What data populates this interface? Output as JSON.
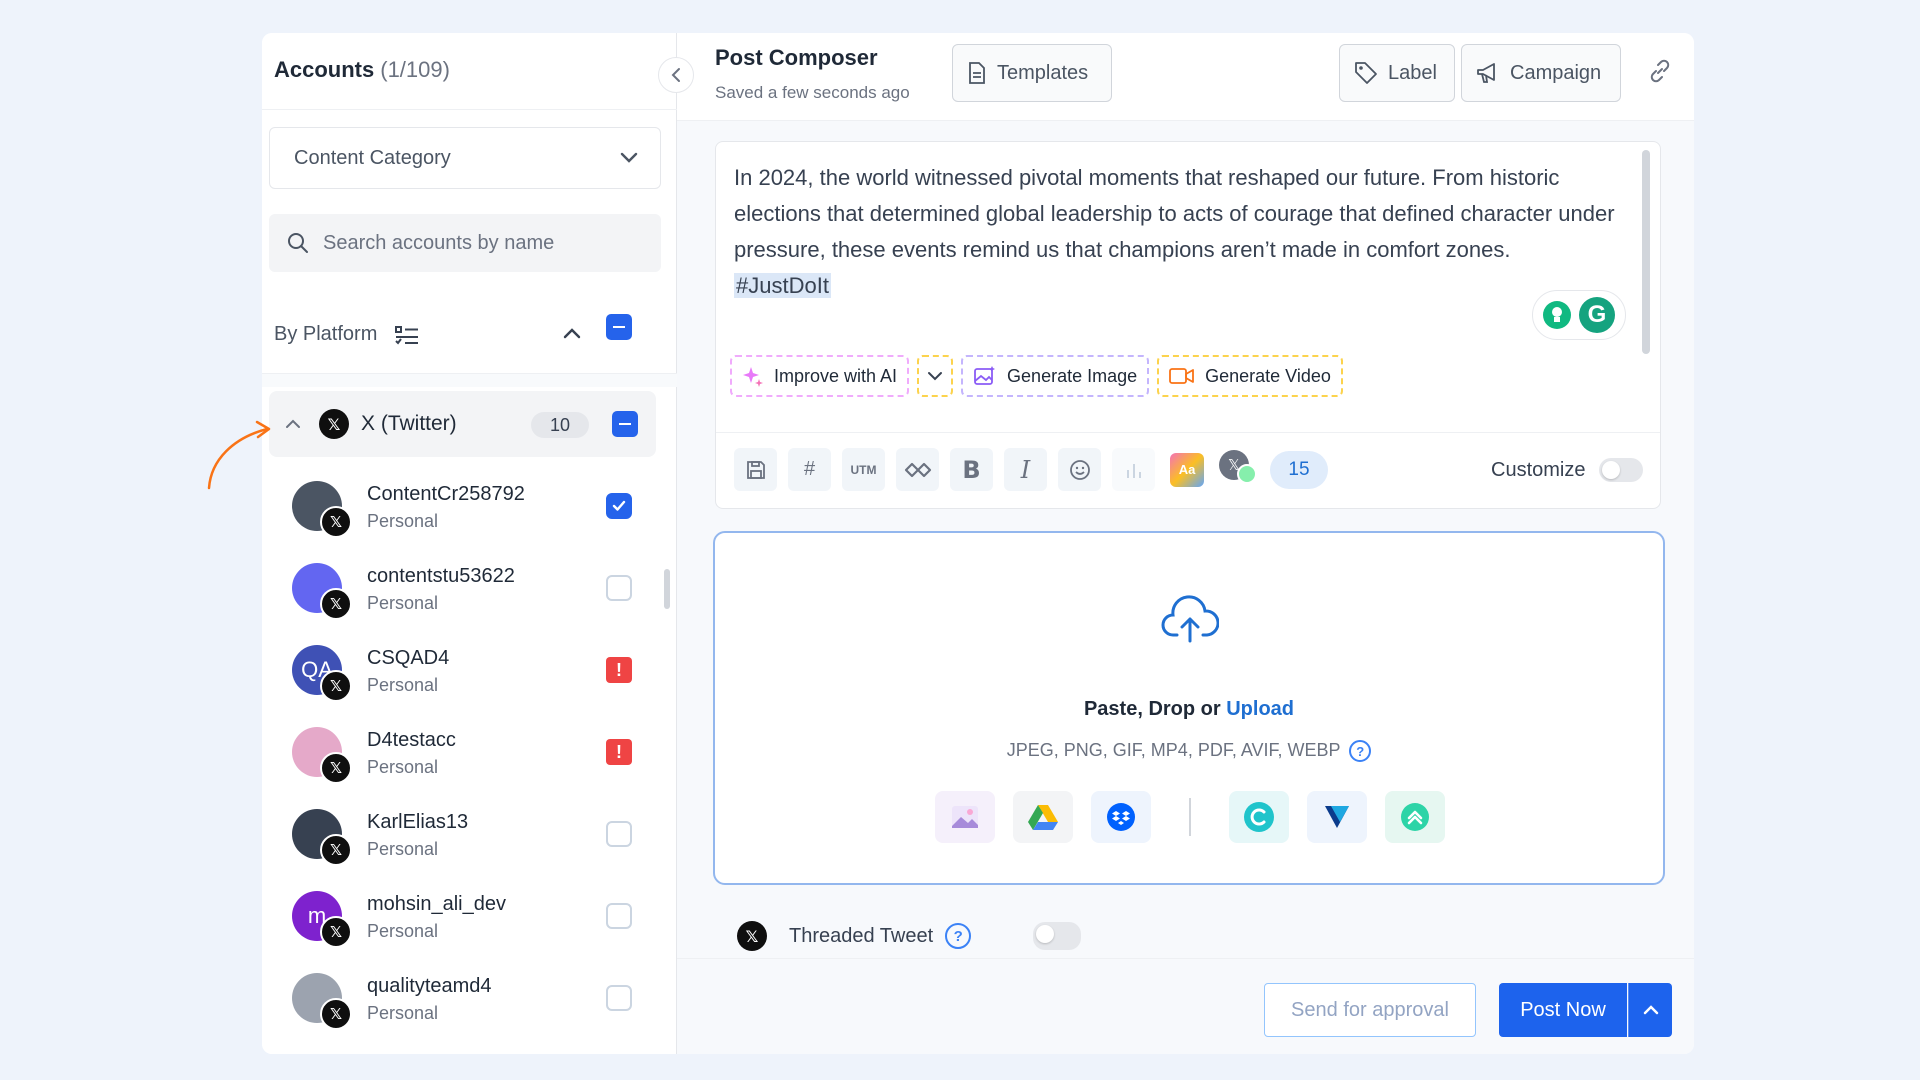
{
  "accounts": {
    "title": "Accounts",
    "count": "(1/109)",
    "category_label": "Content Category",
    "search_placeholder": "Search accounts by name",
    "by_platform_label": "By Platform",
    "platform": {
      "name": "X (Twitter)",
      "count": "10"
    },
    "items": [
      {
        "name": "ContentCr258792",
        "type": "Personal",
        "state": "checked",
        "avatar_color": "#4b5563",
        "avatar_text": ""
      },
      {
        "name": "contentstu53622",
        "type": "Personal",
        "state": "unchecked",
        "avatar_color": "#6366f1",
        "avatar_text": ""
      },
      {
        "name": "CSQAD4",
        "type": "Personal",
        "state": "warning",
        "avatar_color": "#3f51b5",
        "avatar_text": "QA"
      },
      {
        "name": "D4testacc",
        "type": "Personal",
        "state": "warning",
        "avatar_color": "#e5a9c9",
        "avatar_text": ""
      },
      {
        "name": "KarlElias13",
        "type": "Personal",
        "state": "unchecked",
        "avatar_color": "#374151",
        "avatar_text": ""
      },
      {
        "name": "mohsin_ali_dev",
        "type": "Personal",
        "state": "unchecked",
        "avatar_color": "#7e22ce",
        "avatar_text": "m"
      },
      {
        "name": "qualityteamd4",
        "type": "Personal",
        "state": "unchecked",
        "avatar_color": "#9ca3af",
        "avatar_text": ""
      }
    ],
    "warning_glyph": "!"
  },
  "composer": {
    "title": "Post Composer",
    "saved": "Saved a few seconds ago",
    "templates_label": "Templates",
    "label_label": "Label",
    "campaign_label": "Campaign",
    "text_line1": "In 2024, the world witnessed pivotal moments that reshaped our future. From historic elections that determined global leadership to acts of courage that defined character under pressure, these events remind us that champions aren’t made in comfort zones.",
    "hashtag": "#JustDoIt",
    "grammarly_letter": "G",
    "ai": {
      "improve": "Improve with AI",
      "gen_image": "Generate Image",
      "gen_video": "Generate Video"
    },
    "toolbar": {
      "hash": "#",
      "utm": "UTM",
      "bold": "B",
      "italic": "I",
      "aa": "Aa",
      "char_count": "15",
      "customize": "Customize"
    }
  },
  "upload": {
    "text_prefix": "Paste, Drop or ",
    "text_link": "Upload",
    "formats": "JPEG, PNG, GIF, MP4, PDF, AVIF, WEBP",
    "help_glyph": "?"
  },
  "thread": {
    "label": "Threaded Tweet",
    "help_glyph": "?"
  },
  "footer": {
    "send_approval": "Send for approval",
    "post_now": "Post Now"
  },
  "colors": {
    "primary": "#1d63ed",
    "warning": "#ef4444",
    "accent_arrow": "#f97316"
  },
  "icons": {
    "x_glyph": "𝕏"
  }
}
